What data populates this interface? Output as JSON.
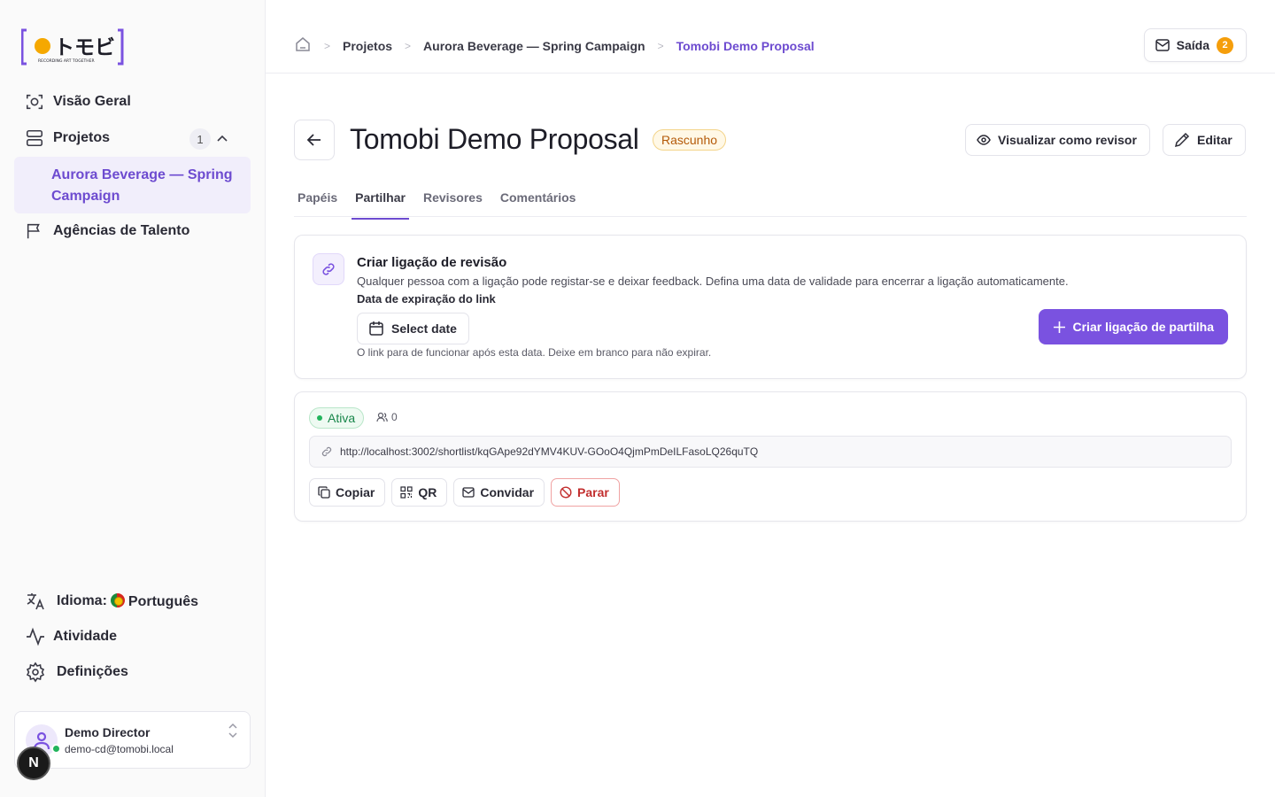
{
  "logo": {
    "text": "トモビ",
    "tagline": "RECORDING ART TOGETHER"
  },
  "sidebar": {
    "items": [
      {
        "label": "Visão Geral",
        "icon": "overview-icon"
      },
      {
        "label": "Projetos",
        "icon": "projects-icon",
        "count": "1"
      },
      {
        "label": "Agências de Talento",
        "icon": "flag-icon"
      }
    ],
    "active_project": "Aurora Beverage — Spring Campaign",
    "bottom": {
      "language_label": "Idioma:",
      "language_value": "Português",
      "activity": "Atividade",
      "settings": "Definições"
    },
    "user": {
      "name": "Demo Director",
      "email": "demo-cd@tomobi.local"
    },
    "n_badge": "N"
  },
  "topbar": {
    "breadcrumbs": [
      "Projetos",
      "Aurora Beverage — Spring Campaign",
      "Tomobi Demo Proposal"
    ],
    "outbox_label": "Saída",
    "outbox_count": "2"
  },
  "header": {
    "title": "Tomobi Demo Proposal",
    "status": "Rascunho",
    "view_as_reviewer": "Visualizar como revisor",
    "edit": "Editar"
  },
  "tabs": [
    {
      "label": "Papéis",
      "active": false
    },
    {
      "label": "Partilhar",
      "active": true
    },
    {
      "label": "Revisores",
      "active": false
    },
    {
      "label": "Comentários",
      "active": false
    }
  ],
  "create_link": {
    "title": "Criar ligação de revisão",
    "description": "Qualquer pessoa com a ligação pode registar-se e deixar feedback. Defina uma data de validade para encerrar a ligação automaticamente.",
    "expiry_label": "Data de expiração do link",
    "date_button": "Select date",
    "hint": "O link para de funcionar após esta data. Deixe em branco para não expirar.",
    "create_button": "Criar ligação de partilha"
  },
  "share_link": {
    "status": "Ativa",
    "viewers": "0",
    "url": "http://localhost:3002/shortlist/kqGApe92dYMV4KUV-GOoO4QjmPmDeILFasoLQ26quTQ",
    "actions": {
      "copy": "Copiar",
      "qr": "QR",
      "invite": "Convidar",
      "stop": "Parar"
    }
  },
  "colors": {
    "accent": "#7a52e0",
    "warning": "#f59e0b",
    "success": "#22b45c",
    "danger": "#c22e2e"
  }
}
